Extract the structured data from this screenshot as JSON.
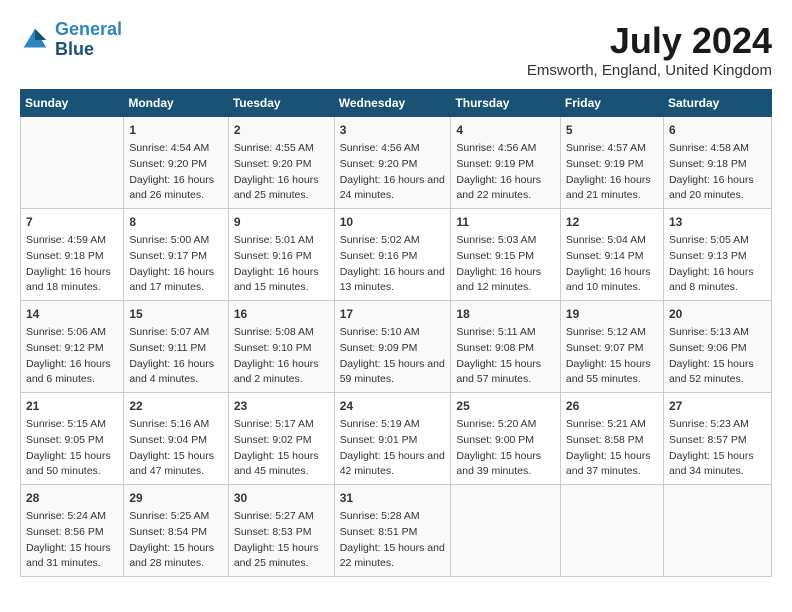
{
  "header": {
    "logo_line1": "General",
    "logo_line2": "Blue",
    "month_title": "July 2024",
    "location": "Emsworth, England, United Kingdom"
  },
  "days_of_week": [
    "Sunday",
    "Monday",
    "Tuesday",
    "Wednesday",
    "Thursday",
    "Friday",
    "Saturday"
  ],
  "weeks": [
    [
      {
        "day": "",
        "sunrise": "",
        "sunset": "",
        "daylight": ""
      },
      {
        "day": "1",
        "sunrise": "Sunrise: 4:54 AM",
        "sunset": "Sunset: 9:20 PM",
        "daylight": "Daylight: 16 hours and 26 minutes."
      },
      {
        "day": "2",
        "sunrise": "Sunrise: 4:55 AM",
        "sunset": "Sunset: 9:20 PM",
        "daylight": "Daylight: 16 hours and 25 minutes."
      },
      {
        "day": "3",
        "sunrise": "Sunrise: 4:56 AM",
        "sunset": "Sunset: 9:20 PM",
        "daylight": "Daylight: 16 hours and 24 minutes."
      },
      {
        "day": "4",
        "sunrise": "Sunrise: 4:56 AM",
        "sunset": "Sunset: 9:19 PM",
        "daylight": "Daylight: 16 hours and 22 minutes."
      },
      {
        "day": "5",
        "sunrise": "Sunrise: 4:57 AM",
        "sunset": "Sunset: 9:19 PM",
        "daylight": "Daylight: 16 hours and 21 minutes."
      },
      {
        "day": "6",
        "sunrise": "Sunrise: 4:58 AM",
        "sunset": "Sunset: 9:18 PM",
        "daylight": "Daylight: 16 hours and 20 minutes."
      }
    ],
    [
      {
        "day": "7",
        "sunrise": "Sunrise: 4:59 AM",
        "sunset": "Sunset: 9:18 PM",
        "daylight": "Daylight: 16 hours and 18 minutes."
      },
      {
        "day": "8",
        "sunrise": "Sunrise: 5:00 AM",
        "sunset": "Sunset: 9:17 PM",
        "daylight": "Daylight: 16 hours and 17 minutes."
      },
      {
        "day": "9",
        "sunrise": "Sunrise: 5:01 AM",
        "sunset": "Sunset: 9:16 PM",
        "daylight": "Daylight: 16 hours and 15 minutes."
      },
      {
        "day": "10",
        "sunrise": "Sunrise: 5:02 AM",
        "sunset": "Sunset: 9:16 PM",
        "daylight": "Daylight: 16 hours and 13 minutes."
      },
      {
        "day": "11",
        "sunrise": "Sunrise: 5:03 AM",
        "sunset": "Sunset: 9:15 PM",
        "daylight": "Daylight: 16 hours and 12 minutes."
      },
      {
        "day": "12",
        "sunrise": "Sunrise: 5:04 AM",
        "sunset": "Sunset: 9:14 PM",
        "daylight": "Daylight: 16 hours and 10 minutes."
      },
      {
        "day": "13",
        "sunrise": "Sunrise: 5:05 AM",
        "sunset": "Sunset: 9:13 PM",
        "daylight": "Daylight: 16 hours and 8 minutes."
      }
    ],
    [
      {
        "day": "14",
        "sunrise": "Sunrise: 5:06 AM",
        "sunset": "Sunset: 9:12 PM",
        "daylight": "Daylight: 16 hours and 6 minutes."
      },
      {
        "day": "15",
        "sunrise": "Sunrise: 5:07 AM",
        "sunset": "Sunset: 9:11 PM",
        "daylight": "Daylight: 16 hours and 4 minutes."
      },
      {
        "day": "16",
        "sunrise": "Sunrise: 5:08 AM",
        "sunset": "Sunset: 9:10 PM",
        "daylight": "Daylight: 16 hours and 2 minutes."
      },
      {
        "day": "17",
        "sunrise": "Sunrise: 5:10 AM",
        "sunset": "Sunset: 9:09 PM",
        "daylight": "Daylight: 15 hours and 59 minutes."
      },
      {
        "day": "18",
        "sunrise": "Sunrise: 5:11 AM",
        "sunset": "Sunset: 9:08 PM",
        "daylight": "Daylight: 15 hours and 57 minutes."
      },
      {
        "day": "19",
        "sunrise": "Sunrise: 5:12 AM",
        "sunset": "Sunset: 9:07 PM",
        "daylight": "Daylight: 15 hours and 55 minutes."
      },
      {
        "day": "20",
        "sunrise": "Sunrise: 5:13 AM",
        "sunset": "Sunset: 9:06 PM",
        "daylight": "Daylight: 15 hours and 52 minutes."
      }
    ],
    [
      {
        "day": "21",
        "sunrise": "Sunrise: 5:15 AM",
        "sunset": "Sunset: 9:05 PM",
        "daylight": "Daylight: 15 hours and 50 minutes."
      },
      {
        "day": "22",
        "sunrise": "Sunrise: 5:16 AM",
        "sunset": "Sunset: 9:04 PM",
        "daylight": "Daylight: 15 hours and 47 minutes."
      },
      {
        "day": "23",
        "sunrise": "Sunrise: 5:17 AM",
        "sunset": "Sunset: 9:02 PM",
        "daylight": "Daylight: 15 hours and 45 minutes."
      },
      {
        "day": "24",
        "sunrise": "Sunrise: 5:19 AM",
        "sunset": "Sunset: 9:01 PM",
        "daylight": "Daylight: 15 hours and 42 minutes."
      },
      {
        "day": "25",
        "sunrise": "Sunrise: 5:20 AM",
        "sunset": "Sunset: 9:00 PM",
        "daylight": "Daylight: 15 hours and 39 minutes."
      },
      {
        "day": "26",
        "sunrise": "Sunrise: 5:21 AM",
        "sunset": "Sunset: 8:58 PM",
        "daylight": "Daylight: 15 hours and 37 minutes."
      },
      {
        "day": "27",
        "sunrise": "Sunrise: 5:23 AM",
        "sunset": "Sunset: 8:57 PM",
        "daylight": "Daylight: 15 hours and 34 minutes."
      }
    ],
    [
      {
        "day": "28",
        "sunrise": "Sunrise: 5:24 AM",
        "sunset": "Sunset: 8:56 PM",
        "daylight": "Daylight: 15 hours and 31 minutes."
      },
      {
        "day": "29",
        "sunrise": "Sunrise: 5:25 AM",
        "sunset": "Sunset: 8:54 PM",
        "daylight": "Daylight: 15 hours and 28 minutes."
      },
      {
        "day": "30",
        "sunrise": "Sunrise: 5:27 AM",
        "sunset": "Sunset: 8:53 PM",
        "daylight": "Daylight: 15 hours and 25 minutes."
      },
      {
        "day": "31",
        "sunrise": "Sunrise: 5:28 AM",
        "sunset": "Sunset: 8:51 PM",
        "daylight": "Daylight: 15 hours and 22 minutes."
      },
      {
        "day": "",
        "sunrise": "",
        "sunset": "",
        "daylight": ""
      },
      {
        "day": "",
        "sunrise": "",
        "sunset": "",
        "daylight": ""
      },
      {
        "day": "",
        "sunrise": "",
        "sunset": "",
        "daylight": ""
      }
    ]
  ]
}
